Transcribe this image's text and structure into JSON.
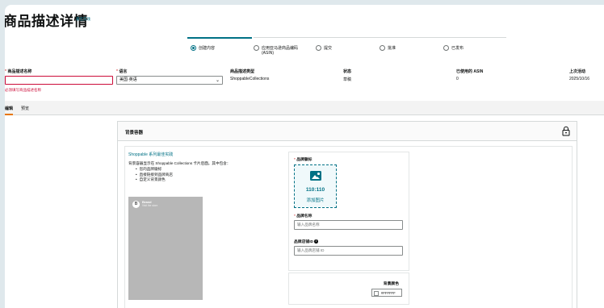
{
  "page": {
    "title": "商品描述详情",
    "best_practice_link": "最佳实践"
  },
  "stepper": {
    "steps": [
      {
        "label": "创建内容",
        "checked": true
      },
      {
        "label": "应用亚马逊商品编码\n(ASIN)",
        "checked": false
      },
      {
        "label": "提交",
        "checked": false
      },
      {
        "label": "批准",
        "checked": false
      },
      {
        "label": "已发布",
        "checked": false
      }
    ]
  },
  "info": {
    "name_label": "商品描述名称",
    "name_value": "",
    "name_error": "必须填写商品描述名称",
    "language_label": "语言",
    "language_value": "美国·英语",
    "type_label": "商品描述类型",
    "type_value": "ShoppableCollections",
    "status_label": "状态",
    "status_value": "草稿",
    "asin_label": "已使用的 ASIN",
    "asin_value": "0",
    "last_activity_label": "上次活动",
    "last_activity_value": "2025/10/16"
  },
  "tabs": {
    "edit": "编辑",
    "preview": "预览"
  },
  "container": {
    "title": "背景容器",
    "sp_link": "Shoppable 系列最佳实践",
    "desc_intro": "背景容器显示在 Shoppable Collections 卡片后面。其中包含：",
    "desc_items": [
      "您的品牌徽标",
      "直接链接到品牌商店",
      "自定义背景颜色"
    ],
    "preview_logo": "B",
    "preview_brand": "Brand",
    "preview_sub": "Visit the store"
  },
  "form": {
    "logo_label": "品牌徽标",
    "upload_size": "110:110",
    "upload_add": "添加图片",
    "brand_name_label": "品牌名称",
    "brand_name_placeholder": "输入品牌名称",
    "store_id_label": "品牌店铺ID",
    "store_id_placeholder": "输入品牌店铺 ID",
    "bg_color_label": "背景颜色",
    "bg_color_value": "#FFFFFF"
  },
  "colors": {
    "accent": "#007185",
    "error": "#cc0c39",
    "tab_highlight": "#e77600"
  },
  "icons": {
    "lock": "lock-icon",
    "image": "image-icon",
    "info": "info-icon",
    "chevron": "chevron-down-icon"
  }
}
